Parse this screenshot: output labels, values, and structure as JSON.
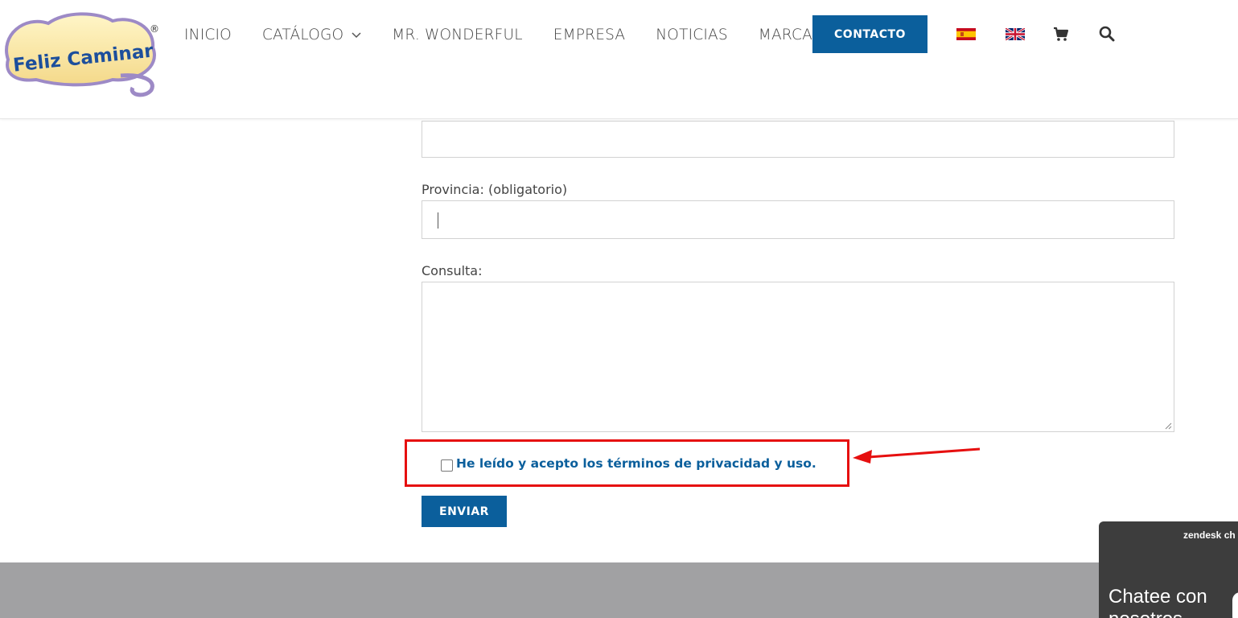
{
  "header": {
    "logo_text": "Feliz Caminar",
    "logo_mark": "®",
    "nav": [
      {
        "label": "INICIO"
      },
      {
        "label": "CATÁLOGO"
      },
      {
        "label": "MR. WONDERFUL"
      },
      {
        "label": "EMPRESA"
      },
      {
        "label": "NOTICIAS"
      },
      {
        "label": "MARCAS"
      }
    ],
    "contact_label": "CONTACTO",
    "icons": [
      "flag-es-icon",
      "flag-uk-icon",
      "cart-icon",
      "search-icon"
    ]
  },
  "form": {
    "provincia_label": "Provincia: (obligatorio)",
    "provincia_value": "",
    "consulta_label": "Consulta:",
    "consulta_value": "",
    "terms_label": "He leído y acepto los términos de privacidad y uso.",
    "terms_checked": false,
    "submit_label": "ENVIAR"
  },
  "chat": {
    "brand": "zendesk ch",
    "title_line1": "Chatee con",
    "title_line2": "nosotros"
  },
  "colors": {
    "primary": "#0b5f9c",
    "annotation_red": "#e60f0f",
    "footer": "#a1a1a3",
    "chat_bg": "#3d3d3d"
  }
}
